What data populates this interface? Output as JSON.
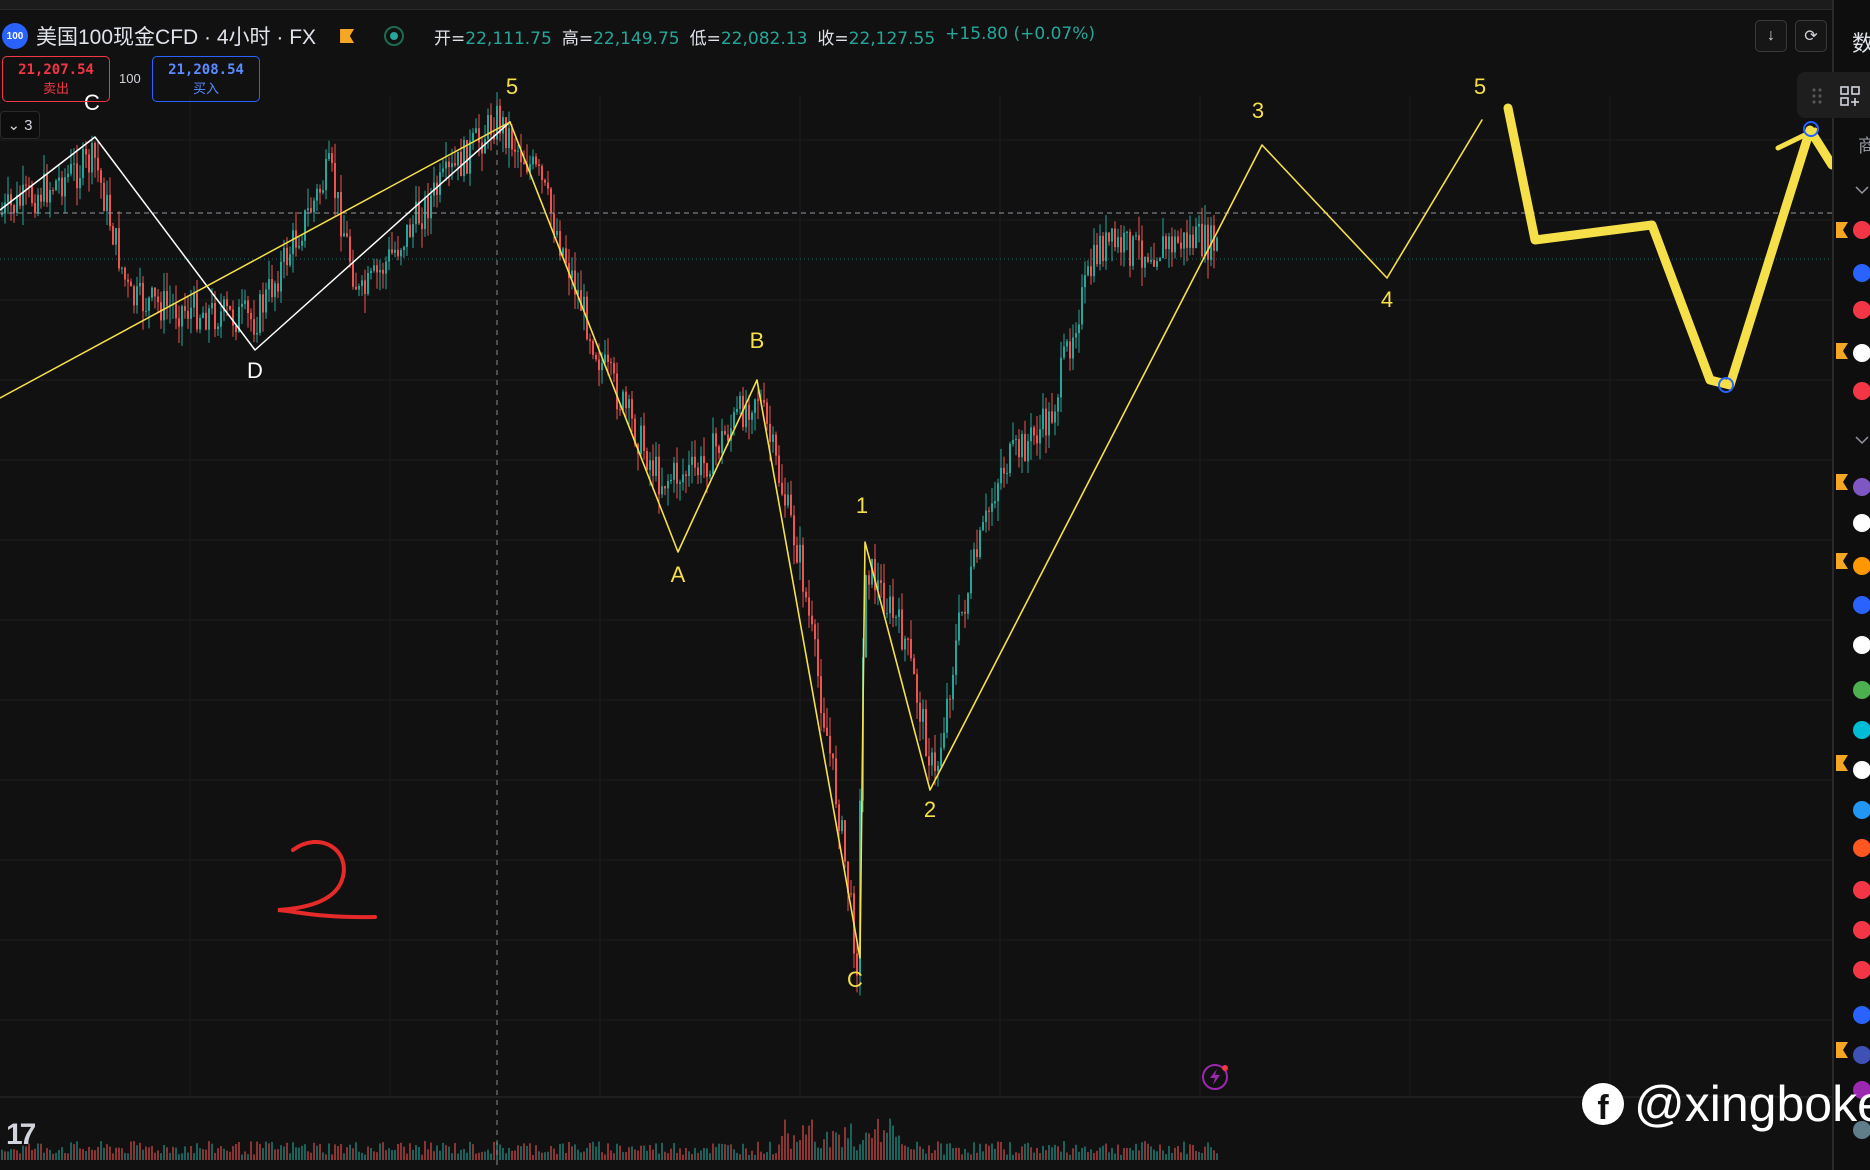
{
  "header": {
    "symbol_badge": "100",
    "title": "美国100现金CFD · 4小时 · FX",
    "ohlc": [
      {
        "k": "开=",
        "v": "22,111.75"
      },
      {
        "k": "高=",
        "v": "22,149.75"
      },
      {
        "k": "低=",
        "v": "22,082.13"
      },
      {
        "k": "收=",
        "v": "22,127.55"
      }
    ],
    "change": "+15.80 (+0.07%)"
  },
  "trade": {
    "sell_price": "21,207.54",
    "sell_label": "卖出",
    "spread": "100",
    "buy_price": "21,208.54",
    "buy_label": "买入"
  },
  "collapse_count": "3",
  "right_panel": {
    "title": "数",
    "tag": "商"
  },
  "watermark": {
    "icon": "f",
    "text": "@xingboke"
  },
  "tv_logo": "17",
  "colors": {
    "up": "#26a69a",
    "down": "#ef5350",
    "wave": "#f5e04a",
    "red_mark": "#e62a2a"
  },
  "chart_data": {
    "type": "line",
    "series": [
      {
        "points": [
          [
            0,
            210
          ],
          [
            95,
            137
          ],
          [
            255,
            350
          ],
          [
            510,
            122
          ]
        ]
      },
      {
        "points": [
          [
            0,
            398
          ],
          [
            510,
            122
          ]
        ]
      },
      {
        "points": [
          [
            510,
            122
          ],
          [
            678,
            552
          ],
          [
            757,
            380
          ],
          [
            860,
            958
          ],
          [
            865,
            542
          ],
          [
            930,
            790
          ],
          [
            1262,
            145
          ],
          [
            1387,
            278
          ],
          [
            1482,
            120
          ]
        ]
      },
      {
        "points": [
          [
            1508,
            108
          ],
          [
            1535,
            240
          ],
          [
            1652,
            225
          ],
          [
            1710,
            380
          ],
          [
            1730,
            385
          ],
          [
            1810,
            130
          ],
          [
            1832,
            165
          ]
        ]
      },
      {
        "points": [
          [
            1778,
            148
          ],
          [
            1815,
            130
          ]
        ]
      }
    ],
    "annotations": [
      {
        "text": "C",
        "x": 92,
        "y": 110
      },
      {
        "text": "D",
        "x": 255,
        "y": 378
      },
      {
        "text": "5",
        "x": 512,
        "y": 94
      },
      {
        "text": "A",
        "x": 678,
        "y": 582
      },
      {
        "text": "B",
        "x": 757,
        "y": 348
      },
      {
        "text": "1",
        "x": 862,
        "y": 513
      },
      {
        "text": "C",
        "x": 855,
        "y": 987
      },
      {
        "text": "2",
        "x": 930,
        "y": 817
      },
      {
        "text": "3",
        "x": 1258,
        "y": 118
      },
      {
        "text": "4",
        "x": 1387,
        "y": 307
      },
      {
        "text": "5",
        "x": 1480,
        "y": 94
      }
    ],
    "handwritten": "2",
    "grid": true
  }
}
